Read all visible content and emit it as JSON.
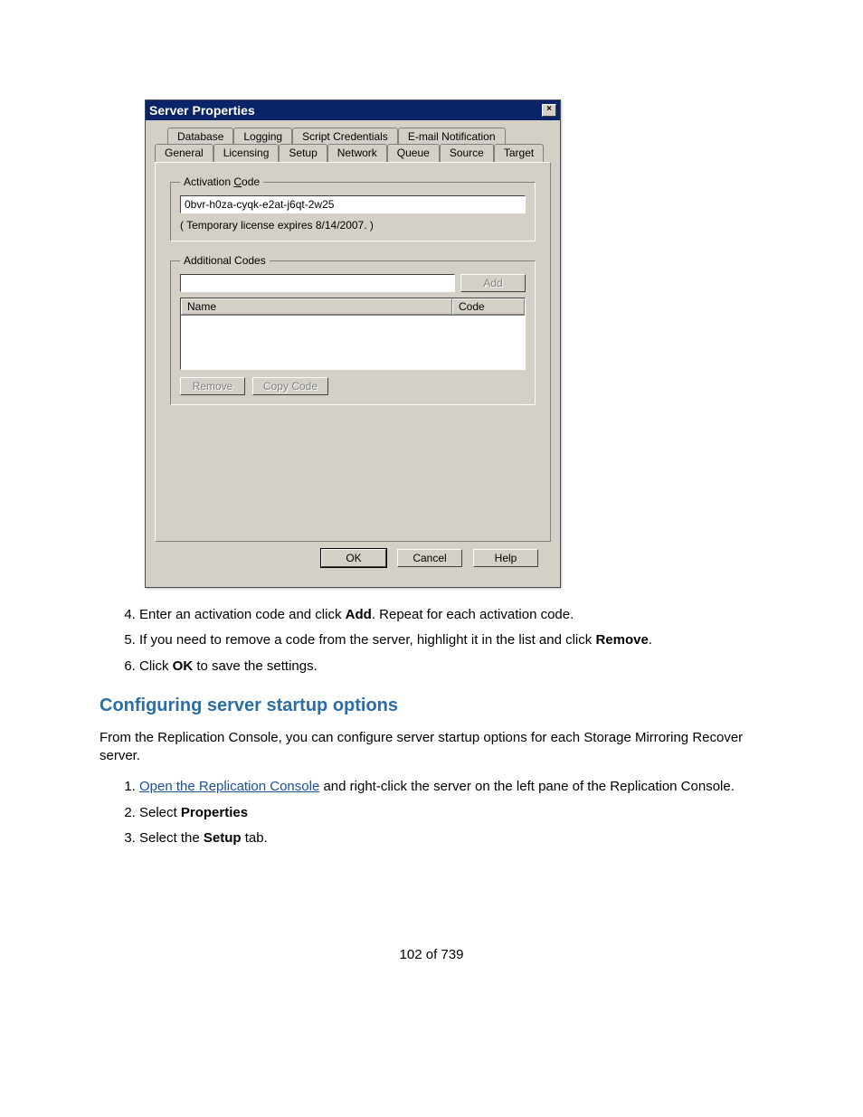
{
  "dialog": {
    "title": "Server Properties",
    "close_label": "×",
    "tabs_back": [
      "Database",
      "Logging",
      "Script Credentials",
      "E-mail Notification"
    ],
    "tabs_front": [
      "General",
      "Licensing",
      "Setup",
      "Network",
      "Queue",
      "Source",
      "Target"
    ],
    "active_tab": "Licensing",
    "activation_group": {
      "legend": "Activation Code",
      "value": "0bvr-h0za-cyqk-e2at-j6qt-2w25",
      "expiry": "( Temporary license expires 8/14/2007. )"
    },
    "additional_group": {
      "legend": "Additional Codes",
      "add_input_value": "",
      "add_label": "Add",
      "columns": {
        "name": "Name",
        "code": "Code"
      },
      "remove_label": "Remove",
      "copy_label": "Copy Code"
    },
    "footer": {
      "ok": "OK",
      "cancel": "Cancel",
      "help": "Help"
    }
  },
  "steps_a": [
    {
      "num": "4.",
      "pre": "Enter an activation code and click ",
      "bold": "Add",
      "post": ". Repeat for each activation code."
    },
    {
      "num": "5.",
      "pre": "If you need to remove a code from the server, highlight it in the list and click ",
      "bold": "Remove",
      "post": "."
    },
    {
      "num": "6.",
      "pre": "Click ",
      "bold": "OK",
      "post": " to save the settings."
    }
  ],
  "section_heading": "Configuring server startup options",
  "intro": "From the Replication Console, you can configure server startup options for each Storage Mirroring Recover server.",
  "steps_b": [
    {
      "num": "1.",
      "link": "Open the Replication Console",
      "post": " and right-click the server on the left pane of the Replication Console."
    },
    {
      "num": "2.",
      "pre": "Select ",
      "bold": "Properties",
      "post": ""
    },
    {
      "num": "3.",
      "pre": "Select the ",
      "bold": "Setup",
      "post": " tab."
    }
  ],
  "page_number": "102 of 739"
}
